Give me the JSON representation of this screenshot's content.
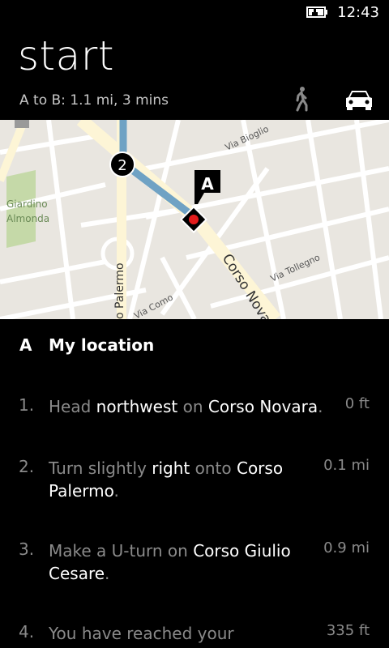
{
  "status": {
    "time": "12:43"
  },
  "header": {
    "title": "start",
    "summary_prefix": "A to B:",
    "summary_value": "1.1 mi, 3 mins"
  },
  "map": {
    "labels": {
      "park": [
        "Giardino",
        "Almonda"
      ],
      "via_bioglio": "Via Bioglio",
      "corso_novara": "Corso Nova",
      "via_tollegno": "Via Tollegno",
      "palermo": "o Palermo",
      "via_como": "Via Como",
      "marker_2": "2",
      "marker_a": "A"
    }
  },
  "start": {
    "letter": "A",
    "label": "My location"
  },
  "steps": [
    {
      "num": "1.",
      "parts": [
        "Head ",
        "northwest",
        " on ",
        "Corso Novara",
        "."
      ],
      "dist": "0 ft"
    },
    {
      "num": "2.",
      "parts": [
        "Turn slightly ",
        "right",
        " onto ",
        "Corso Palermo",
        "."
      ],
      "dist": "0.1 mi"
    },
    {
      "num": "3.",
      "parts": [
        "Make a U-turn on ",
        "Corso Giulio Cesare",
        "."
      ],
      "dist": "0.9 mi"
    },
    {
      "num": "4.",
      "parts": [
        "You have reached your"
      ],
      "dist": "335 ft"
    }
  ],
  "colors": {
    "route": "#6fa2c4",
    "marker_dot": "#e31b1b",
    "map_bg": "#e9e6e0",
    "park": "#c5d9a8"
  },
  "icons": {
    "battery": "battery-charging-icon",
    "walk": "walk-icon",
    "car": "car-icon"
  }
}
